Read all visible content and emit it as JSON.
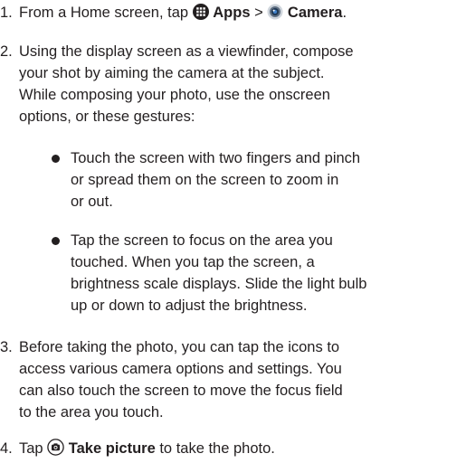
{
  "steps": [
    {
      "num": "1.",
      "pre": "From a Home screen, tap ",
      "apps_icon": "apps-grid-icon",
      "apps_label": "Apps",
      "sep": " > ",
      "camera_icon": "camera-app-icon",
      "camera_label": "Camera",
      "post": "."
    },
    {
      "num": "2.",
      "lines": [
        "Using the display screen as a viewfinder, compose",
        "your shot by aiming the camera at the subject.",
        "While composing your photo, use the onscreen",
        "options, or these gestures:"
      ],
      "bullets": [
        {
          "lines": [
            "Touch the screen with two fingers and pinch",
            "or spread them on the screen to zoom in",
            "or out."
          ]
        },
        {
          "lines": [
            "Tap the screen to focus on the area you",
            "touched. When you tap the screen, a",
            "brightness scale displays. Slide the light bulb",
            "up or down to adjust the brightness."
          ]
        }
      ]
    },
    {
      "num": "3.",
      "lines": [
        "Before taking the photo, you can tap the icons to",
        "access various camera options and settings. You",
        "can also touch the screen to move the focus field",
        "to the area you touch."
      ]
    },
    {
      "num": "4.",
      "pre": "Tap ",
      "shutter_icon": "take-picture-icon",
      "label": "Take picture",
      "post": " to take the photo."
    }
  ]
}
